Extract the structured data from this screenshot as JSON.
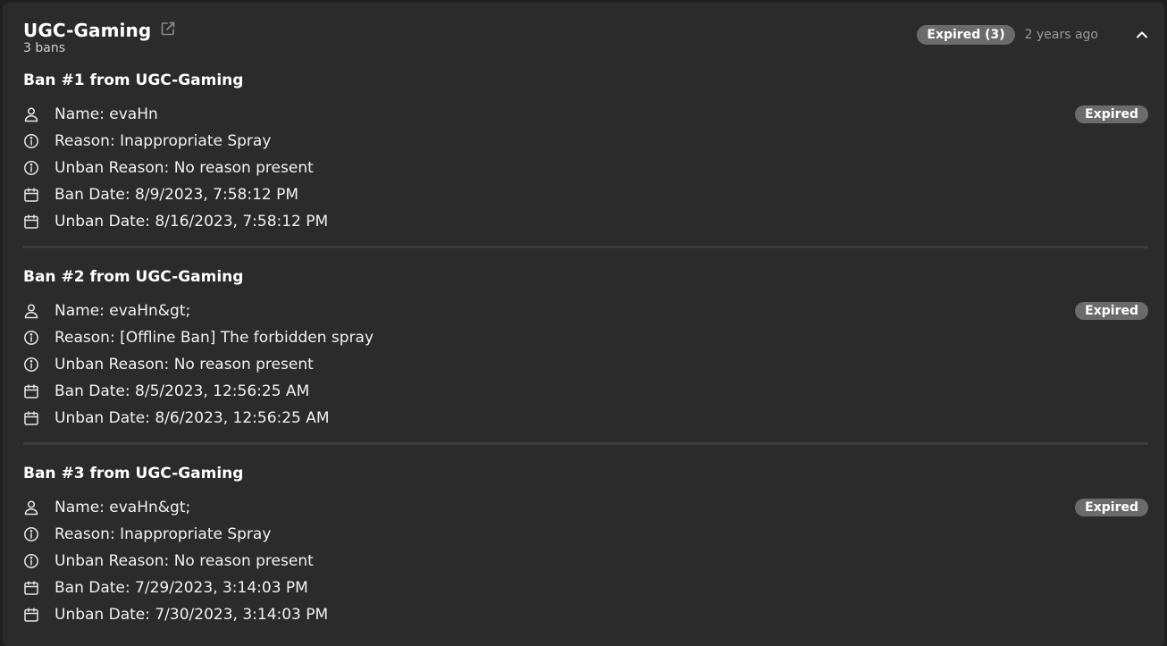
{
  "header": {
    "title": "UGC-Gaming",
    "subtitle": "3 bans",
    "status_badge": "Expired (3)",
    "time_ago": "2 years ago",
    "external_link_icon": "external-link-icon",
    "collapse_icon": "chevron-up-icon"
  },
  "colors": {
    "background": "#2b2b2b",
    "badge": "#6b6b6b",
    "muted_text": "#9a9a9a"
  },
  "bans": [
    {
      "title": "Ban #1 from UGC-Gaming",
      "status": "Expired",
      "name": "Name: evaHn",
      "reason": "Reason: Inappropriate Spray",
      "unban_reason": "Unban Reason: No reason present",
      "ban_date": "Ban Date: 8/9/2023, 7:58:12 PM",
      "unban_date": "Unban Date: 8/16/2023, 7:58:12 PM"
    },
    {
      "title": "Ban #2 from UGC-Gaming",
      "status": "Expired",
      "name": "Name: evaHn&gt;",
      "reason": "Reason: [Offline Ban] The forbidden spray",
      "unban_reason": "Unban Reason: No reason present",
      "ban_date": "Ban Date: 8/5/2023, 12:56:25 AM",
      "unban_date": "Unban Date: 8/6/2023, 12:56:25 AM"
    },
    {
      "title": "Ban #3 from UGC-Gaming",
      "status": "Expired",
      "name": "Name: evaHn&gt;",
      "reason": "Reason: Inappropriate Spray",
      "unban_reason": "Unban Reason: No reason present",
      "ban_date": "Ban Date: 7/29/2023, 3:14:03 PM",
      "unban_date": "Unban Date: 7/30/2023, 3:14:03 PM"
    }
  ]
}
